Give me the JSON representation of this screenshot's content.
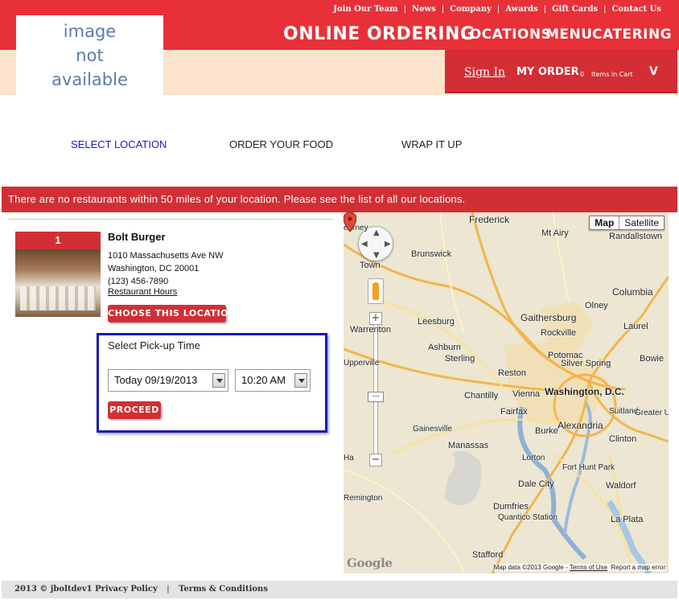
{
  "header": {
    "logo_text": [
      "image",
      "not",
      "available"
    ],
    "top_links": [
      "Join Our Team",
      "News",
      "Company",
      "Awards",
      "Gift Cards",
      "Contact Us"
    ],
    "online_ordering": "ONLINE ORDERING",
    "nav": [
      "LOCATIONS",
      "MENU",
      "CATERING"
    ],
    "sign_in": "Sign In",
    "my_order": "MY ORDER",
    "cart_count": "0",
    "cart_label": "Items in Cart",
    "cart_toggle": "V"
  },
  "steps": [
    {
      "label": "SELECT LOCATION",
      "active": true
    },
    {
      "label": "ORDER YOUR FOOD",
      "active": false
    },
    {
      "label": "WRAP IT UP",
      "active": false
    }
  ],
  "alert": "There are no restaurants within 50 miles of your location. Please see the list of all our locations.",
  "location": {
    "number": "1",
    "name": "Bolt Burger",
    "address1": "1010 Massachusetts Ave NW",
    "address2": "Washington, DC 20001",
    "phone": "(123) 456-7890",
    "hours_link": "Restaurant Hours",
    "choose_button": "CHOOSE THIS LOCATION"
  },
  "pickup": {
    "label": "Select Pick-up Time",
    "date_value": "Today 09/19/2013",
    "time_value": "10:20 AM",
    "proceed_button": "PROCEED"
  },
  "map": {
    "type_map": "Map",
    "type_satellite": "Satellite",
    "labels": [
      {
        "text": "Frederick",
        "size": 12
      },
      {
        "text": "Mt Airy",
        "size": 11
      },
      {
        "text": "Randallstown",
        "size": 11
      },
      {
        "text": "Brunswick",
        "size": 11
      },
      {
        "text": "Town",
        "size": 11
      },
      {
        "text": "Columbia",
        "size": 12
      },
      {
        "text": "Gaithersburg",
        "size": 12
      },
      {
        "text": "Leesburg",
        "size": 11
      },
      {
        "text": "Rockville",
        "size": 11
      },
      {
        "text": "Laurel",
        "size": 11
      },
      {
        "text": "Olney",
        "size": 11
      },
      {
        "text": "Ashburn",
        "size": 11
      },
      {
        "text": "Potomac",
        "size": 11
      },
      {
        "text": "Silver Spring",
        "size": 11
      },
      {
        "text": "Bowie",
        "size": 11
      },
      {
        "text": "Sterling",
        "size": 11
      },
      {
        "text": "Reston",
        "size": 11
      },
      {
        "text": "Upperville",
        "size": 10
      },
      {
        "text": "Chantilly",
        "size": 11
      },
      {
        "text": "Vienna",
        "size": 11
      },
      {
        "text": "Washington, D.C.",
        "size": 12
      },
      {
        "text": "Suitland",
        "size": 10
      },
      {
        "text": "Greater Upper",
        "size": 10
      },
      {
        "text": "Fairfax",
        "size": 11
      },
      {
        "text": "Alexandria",
        "size": 12
      },
      {
        "text": "Gainesville",
        "size": 10
      },
      {
        "text": "Burke",
        "size": 11
      },
      {
        "text": "Clinton",
        "size": 11
      },
      {
        "text": "Manassas",
        "size": 11
      },
      {
        "text": "Lorton",
        "size": 10
      },
      {
        "text": "Fort Hunt Park",
        "size": 10
      },
      {
        "text": "Waldorf",
        "size": 11
      },
      {
        "text": "Dale City",
        "size": 11
      },
      {
        "text": "Dumfries",
        "size": 11
      },
      {
        "text": "Quantico Station",
        "size": 10
      },
      {
        "text": "La Plata",
        "size": 11
      },
      {
        "text": "Stafford",
        "size": 11
      },
      {
        "text": "Warrenton",
        "size": 11
      },
      {
        "text": "earney",
        "size": 10
      },
      {
        "text": "Ha",
        "size": 10
      },
      {
        "text": "Remington",
        "size": 10
      }
    ],
    "google_logo": "Google",
    "attribution_prefix": "Map data ©2013 Google - ",
    "terms": "Terms of Use",
    "report": "Report a map error"
  },
  "footer": {
    "copyright": "2013 © jboltdev1",
    "privacy": "Privacy Policy",
    "terms": "Terms & Conditions"
  },
  "colors": {
    "brand_red": "#e83038",
    "alert_red": "#d12f35",
    "peach": "#fbe3cc",
    "active_step": "#1a1acc",
    "highlight_border": "#1a1ab8"
  }
}
